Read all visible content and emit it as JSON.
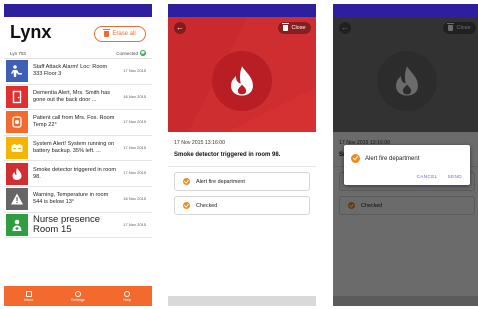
{
  "inbox": {
    "title": "Lynx",
    "erase_all_label": "Erase all",
    "device_id": "Lyn 703",
    "connection_status": "Connected",
    "alerts": [
      {
        "text": "Staff Attack Alarm! Loc: Room 333 Floor 3",
        "date": "17 Nov 2015",
        "icon": "person-attack-icon",
        "color": "#3f5fb7",
        "large": false
      },
      {
        "text": "Dementia Alert, Mrs. Smith has gone out the back door ...",
        "date": "16 Nov 2015",
        "icon": "door-exit-icon",
        "color": "#e02f2f",
        "large": false
      },
      {
        "text": "Patient call from Mrs. Fox. Room Temp 22°",
        "date": "17 Nov 2015",
        "icon": "patient-call-icon",
        "color": "#f26a2e",
        "large": false
      },
      {
        "text": "System Alert! System running on battery backup. 35% left. ...",
        "date": "17 Nov 2015",
        "icon": "battery-icon",
        "color": "#f5b400",
        "large": false
      },
      {
        "text": "Smoke detector triggered in room 98.",
        "date": "17 Nov 2015",
        "icon": "fire-icon",
        "color": "#d22e31",
        "large": false
      },
      {
        "text": "Warning, Temperature in room 544 is below 13°",
        "date": "16 Nov 2015",
        "icon": "warning-icon",
        "color": "#666666",
        "large": false
      },
      {
        "text": "Nurse presence Room 15",
        "date": "17 Nov 2015",
        "icon": "nurse-presence-icon",
        "color": "#2e9e3e",
        "large": true
      }
    ],
    "nav": [
      {
        "label": "Inbox",
        "icon": "inbox-icon"
      },
      {
        "label": "Settings",
        "icon": "settings-icon"
      },
      {
        "label": "Help",
        "icon": "help-icon"
      }
    ]
  },
  "detail": {
    "close_label": "Close",
    "date": "17 Nov 2015 13:16:00",
    "message": "Smoke detector triggered in room 98.",
    "actions": [
      {
        "label": "Alert fire department"
      },
      {
        "label": "Checked"
      }
    ]
  },
  "dialog": {
    "message": "Alert fire department",
    "cancel_label": "CANCEL",
    "send_label": "SEND"
  },
  "colors": {
    "status_bar": "#2d1f9e",
    "accent": "#f26a2e",
    "fire_red": "#d22e31",
    "check_orange": "#f08a1d",
    "dialog_button": "#6b5ed6"
  }
}
